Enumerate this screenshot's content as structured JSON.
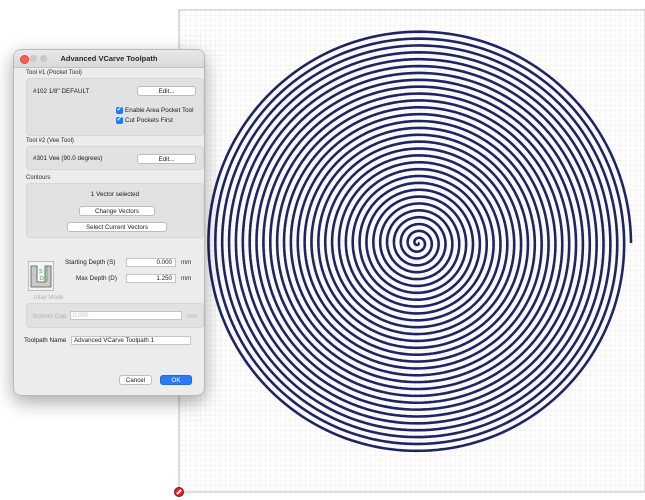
{
  "dialog": {
    "title": "Advanced VCarve Toolpath",
    "tool1": {
      "section_label": "Tool #1 (Pocket Tool)",
      "name": "#102 1/8\" DEFAULT",
      "edit_label": "Edit...",
      "enable_area_pocket": {
        "label": "Enable Area Pocket Tool",
        "checked": true
      },
      "cut_pockets_first": {
        "label": "Cut Pockets First",
        "checked": true
      }
    },
    "tool2": {
      "section_label": "Tool #2 (Vee Tool)",
      "name": "#301 Vee (90.0 degrees)",
      "edit_label": "Edit..."
    },
    "contours": {
      "section_label": "Contours",
      "selection_text": "1 Vector selected",
      "change_vectors_label": "Change Vectors",
      "select_current_label": "Select Current Vectors"
    },
    "depth": {
      "starting_label": "Starting Depth (S)",
      "starting_value": "0.000",
      "max_label": "Max Depth (D)",
      "max_value": "1.250",
      "unit": "mm",
      "diagram_s": "S",
      "diagram_d": "D"
    },
    "inlay": {
      "section_label": "Inlay Mode",
      "bottom_gap_label": "Bottom Gap",
      "bottom_gap_value": "0.000",
      "unit": "mm"
    },
    "toolpath_name": {
      "label": "Toolpath Name",
      "value": "Advanced VCarve Toolpath 1"
    },
    "cancel_label": "Cancel",
    "ok_label": "OK"
  },
  "colors": {
    "spiral": "#1e2466",
    "grid": "#d3d3d3",
    "accent": "#2a7cf6",
    "origin": "#e0231c"
  }
}
